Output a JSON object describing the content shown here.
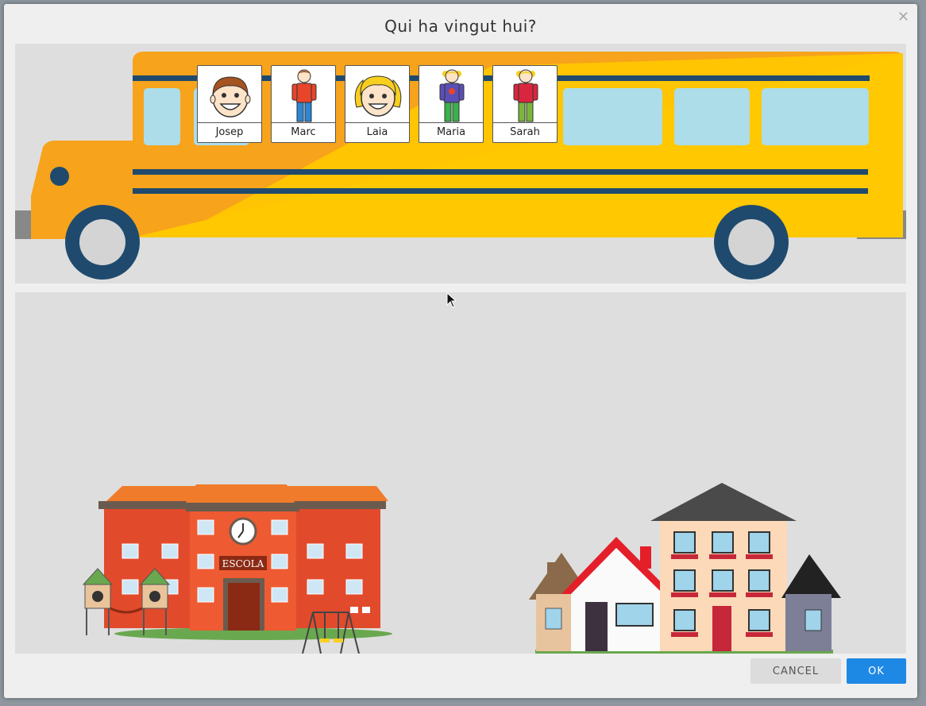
{
  "dialog": {
    "title": "Qui ha vingut hui?",
    "close_icon": "close-icon"
  },
  "cards": [
    {
      "label": "Josep",
      "icon": "boy-face-icon"
    },
    {
      "label": "Marc",
      "icon": "boy-figure-icon"
    },
    {
      "label": "Laia",
      "icon": "girl-face-icon"
    },
    {
      "label": "Maria",
      "icon": "girl-figure-icon"
    },
    {
      "label": "Sarah",
      "icon": "girl-figure-icon"
    }
  ],
  "school": {
    "sign": "ESCOLA"
  },
  "buttons": {
    "cancel": "CANCEL",
    "ok": "OK"
  },
  "colors": {
    "accent": "#1e88e5",
    "bus_yellow": "#ffc800",
    "bus_orange": "#f7a31c",
    "school_red": "#e24a2c"
  }
}
